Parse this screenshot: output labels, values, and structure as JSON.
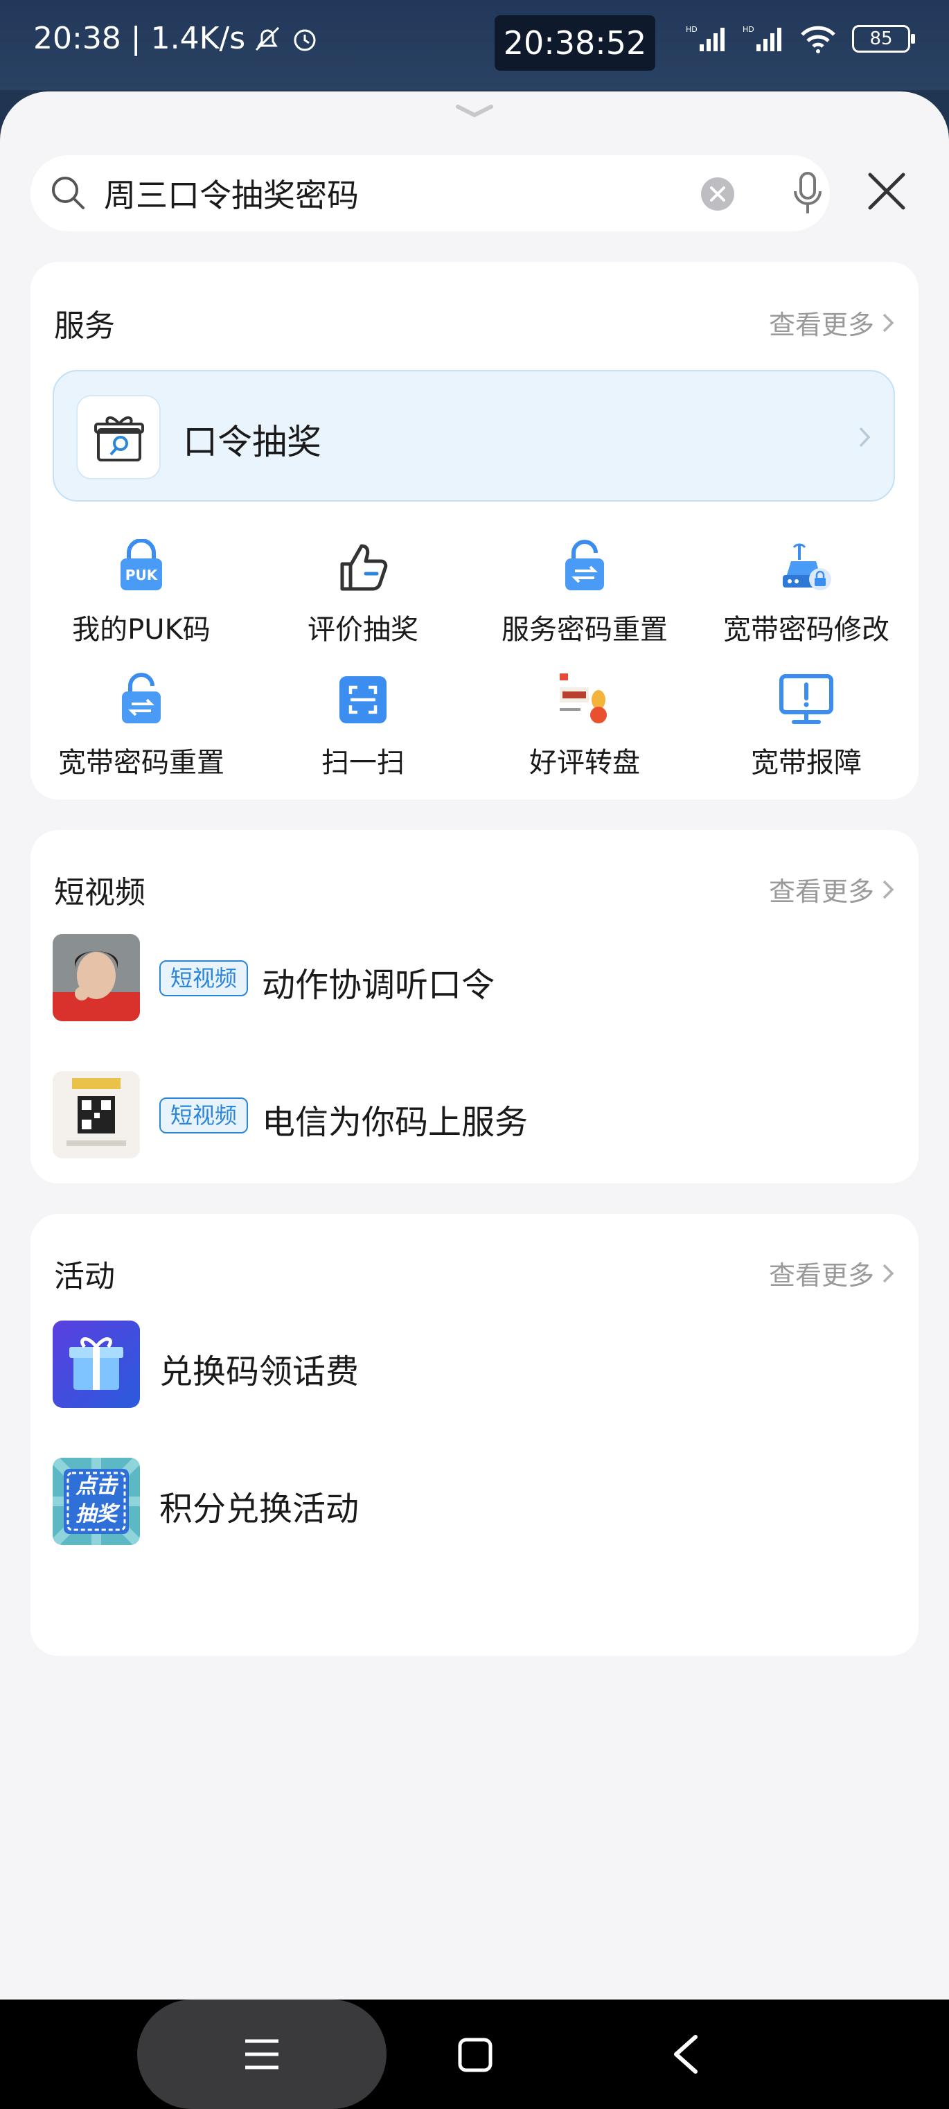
{
  "status_bar": {
    "left_text": "20:38 | 1.4K/s",
    "clock": "20:38:52",
    "battery": "85",
    "signal_label_1": "HD",
    "signal_label_2": "HD"
  },
  "search": {
    "value": "周三口令抽奖密码"
  },
  "services": {
    "title": "服务",
    "more": "查看更多",
    "highlight_label": "口令抽奖",
    "items": [
      {
        "label": "我的PUK码",
        "icon": "puk-lock-icon",
        "badge": "PUK"
      },
      {
        "label": "评价抽奖",
        "icon": "thumbs-up-icon"
      },
      {
        "label": "服务密码重置",
        "icon": "lock-reset-icon"
      },
      {
        "label": "宽带密码修改",
        "icon": "router-lock-icon"
      },
      {
        "label": "宽带密码重置",
        "icon": "lock-reset-icon"
      },
      {
        "label": "扫一扫",
        "icon": "scan-icon"
      },
      {
        "label": "好评转盘",
        "icon": "prize-wheel-image"
      },
      {
        "label": "宽带报障",
        "icon": "monitor-alert-icon"
      }
    ]
  },
  "videos": {
    "title": "短视频",
    "more": "查看更多",
    "items": [
      {
        "tag": "短视频",
        "title": "动作协调听口令"
      },
      {
        "tag": "短视频",
        "title": "电信为你码上服务"
      }
    ]
  },
  "activities": {
    "title": "活动",
    "more": "查看更多",
    "items": [
      {
        "title": "兑换码领话费"
      },
      {
        "title": "积分兑换活动",
        "thumb_text": "点击抽奖"
      }
    ]
  },
  "colors": {
    "accent_blue": "#2a86d9",
    "highlight_bg": "#e9f4fd",
    "page_bg": "#f5f5f7"
  }
}
